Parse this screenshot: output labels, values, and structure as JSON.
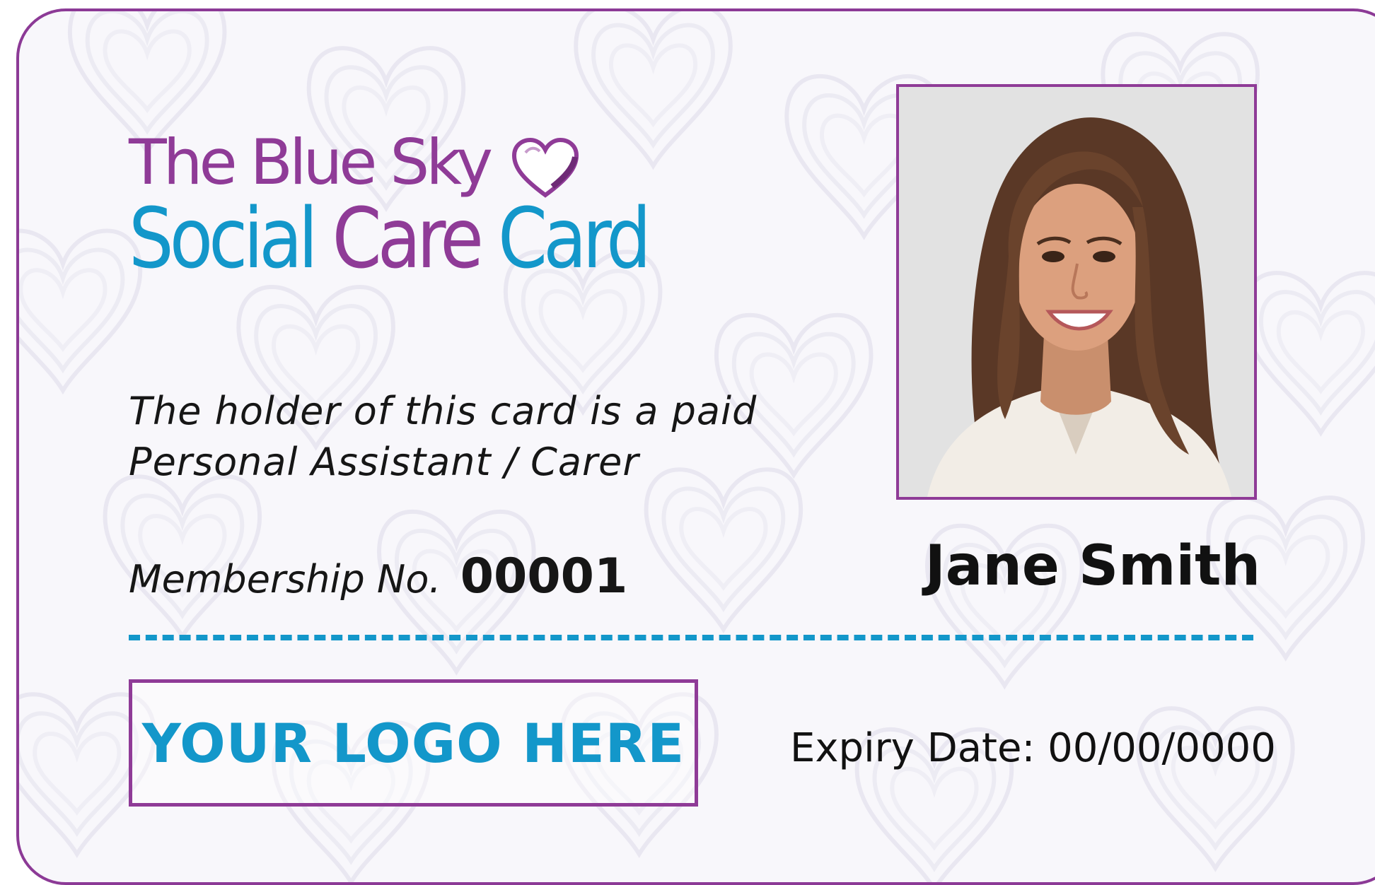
{
  "card": {
    "brand": {
      "line1_prefix": "The",
      "line1_name": "Blue Sky",
      "line2_word1": "Social",
      "line2_word2": "Care",
      "line2_word3": "Card"
    },
    "holder_statement_line1": "The holder of this card is a paid",
    "holder_statement_line2": "Personal Assistant / Carer",
    "membership_label": "Membership No.",
    "membership_number": "00001",
    "holder_name": "Jane Smith",
    "logo_placeholder": "YOUR LOGO HERE",
    "expiry_label": "Expiry Date:",
    "expiry_value": "00/00/0000"
  },
  "colors": {
    "purple": "#8f3b97",
    "blue": "#1397ca",
    "text": "#161616",
    "background": "#f8f7fb"
  },
  "icons": {
    "brand_heart": "heart-icon",
    "photo": "person-photo"
  }
}
